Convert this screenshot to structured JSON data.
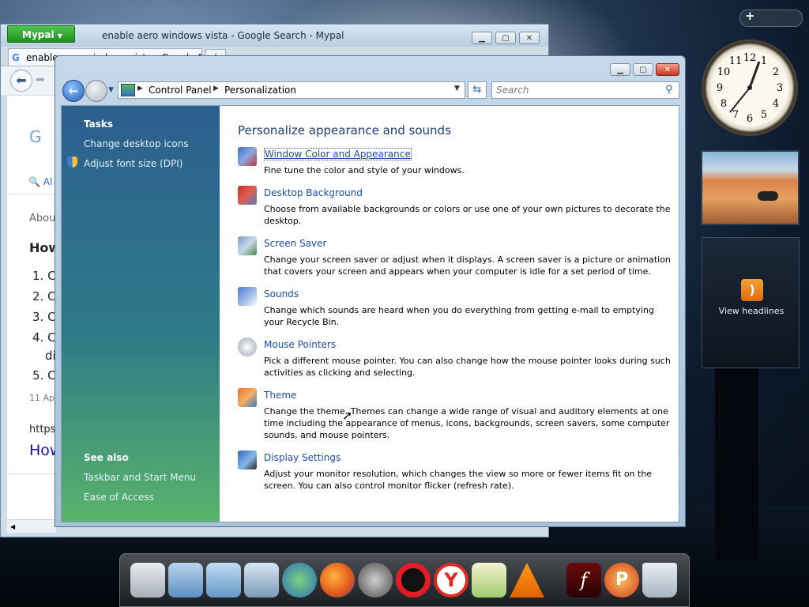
{
  "desktop": {
    "gadgets": {
      "clock_numbers": [
        "12",
        "1",
        "2",
        "3",
        "4",
        "5",
        "6",
        "7",
        "8",
        "9",
        "10",
        "11"
      ],
      "feed_label": "View headlines"
    },
    "dock_icons": [
      "presentation-icon",
      "folder-icon",
      "pictures-folder-icon",
      "display-icon",
      "contacts-icon",
      "firefox-icon",
      "raccoon-icon",
      "opera-icon",
      "yandex-icon",
      "notepad-icon",
      "vlc-icon",
      "flash-icon",
      "pidgin-icon",
      "recycle-bin-icon"
    ]
  },
  "bg_window": {
    "brand": "Mypal",
    "title": "enable aero windows vista - Google Search - Mypal",
    "tab_label": "enable aero windows vista - Google Search",
    "tab_favicon": "G",
    "new_tab": "+",
    "page": {
      "search_tab": "Al",
      "about": "About",
      "heading": "How",
      "list": [
        "1. C",
        "2. C",
        "3. C",
        "4. C",
        "5. C"
      ],
      "list_tail": "di",
      "date": "11 Ap",
      "url": "https:",
      "link": "How"
    }
  },
  "cp_window": {
    "address": {
      "segments": [
        "Control Panel",
        "Personalization"
      ]
    },
    "search_placeholder": "Search",
    "left_pane": {
      "tasks_heading": "Tasks",
      "tasks": [
        "Change desktop icons",
        "Adjust font size (DPI)"
      ],
      "see_also_heading": "See also",
      "see_also": [
        "Taskbar and Start Menu",
        "Ease of Access"
      ]
    },
    "content": {
      "title": "Personalize appearance and sounds",
      "items": [
        {
          "label": "Window Color and Appearance",
          "desc": "Fine tune the color and style of your windows."
        },
        {
          "label": "Desktop Background",
          "desc": "Choose from available backgrounds or colors or use one of your own pictures to decorate the desktop."
        },
        {
          "label": "Screen Saver",
          "desc": "Change your screen saver or adjust when it displays. A screen saver is a picture or animation that covers your screen and appears when your computer is idle for a set period of time."
        },
        {
          "label": "Sounds",
          "desc": "Change which sounds are heard when you do everything from getting e-mail to emptying your Recycle Bin."
        },
        {
          "label": "Mouse Pointers",
          "desc": "Pick a different mouse pointer. You can also change how the mouse pointer looks during such activities as clicking and selecting."
        },
        {
          "label": "Theme",
          "desc": "Change the theme. Themes can change a wide range of visual and auditory elements at one time including the appearance of menus, icons, backgrounds, screen savers, some computer sounds, and mouse pointers."
        },
        {
          "label": "Display Settings",
          "desc": "Adjust your monitor resolution, which changes the view so more or fewer items fit on the screen. You can also control monitor flicker (refresh rate)."
        }
      ]
    }
  }
}
